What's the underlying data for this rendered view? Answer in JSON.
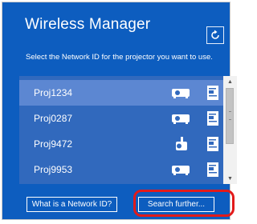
{
  "window": {
    "title": "Wireless Manager",
    "refresh_icon": "refresh-icon",
    "instruction": "Select the Network ID for the projector you want to use."
  },
  "projectors": [
    {
      "name": "Proj1234",
      "device_icon": "projector-icon",
      "selected": true
    },
    {
      "name": "Proj0287",
      "device_icon": "projector-icon",
      "selected": false
    },
    {
      "name": "Proj9472",
      "device_icon": "ceiling-projector-icon",
      "selected": false
    },
    {
      "name": "Proj9953",
      "device_icon": "projector-icon",
      "selected": false
    }
  ],
  "buttons": {
    "what_is": "What is a Network ID?",
    "search_further": "Search further..."
  },
  "colors": {
    "panel": "#0d5dbf",
    "list": "#3169bd",
    "selected_row": "#5c87d2",
    "highlight": "#e21a1a"
  }
}
